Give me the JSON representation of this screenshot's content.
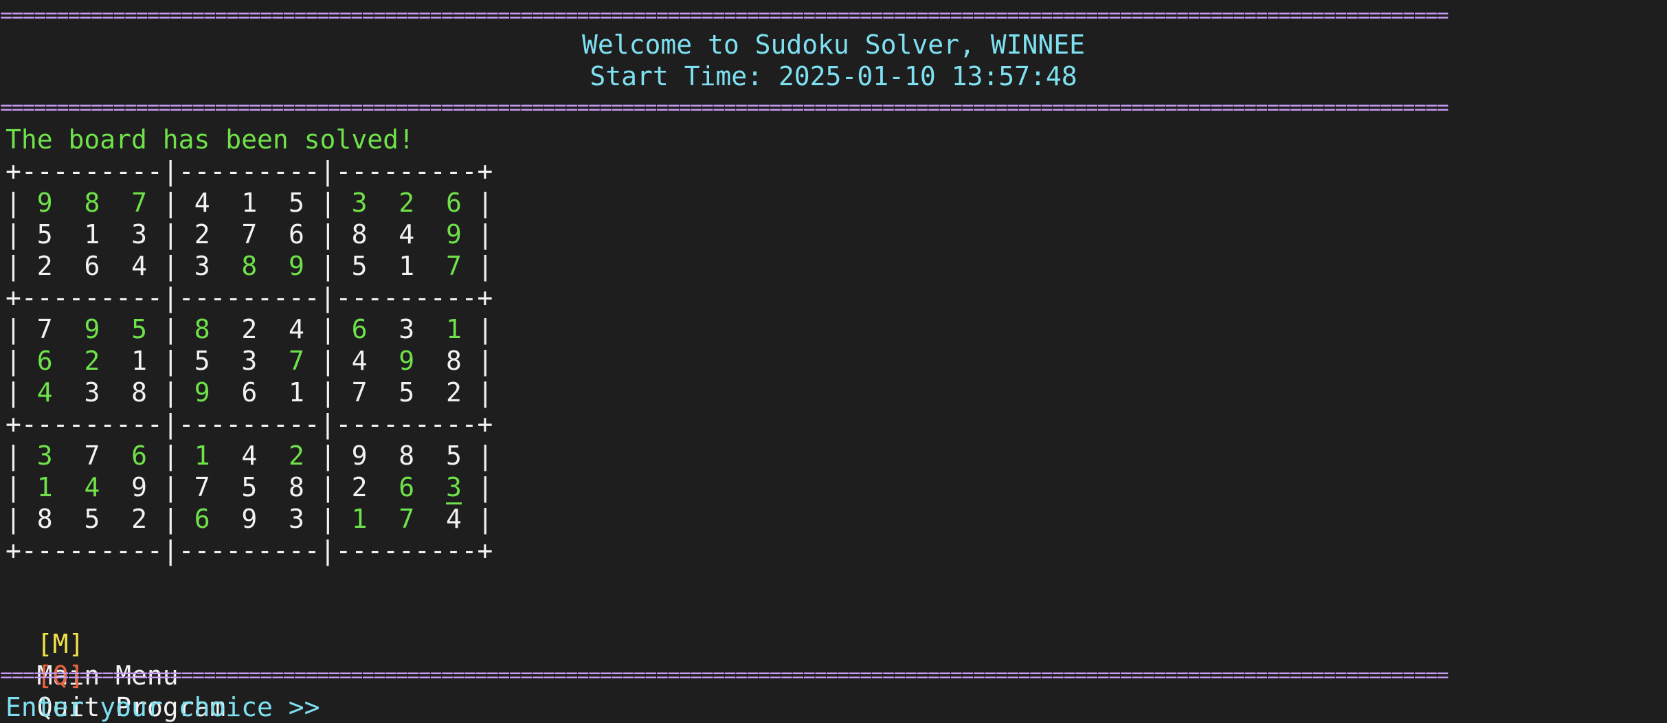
{
  "header": {
    "separator": "================================================================================================================================",
    "welcome": "Welcome to Sudoku Solver, WINNEE",
    "start_time": "Start Time: 2025-01-10 13:57:48"
  },
  "status": "The board has been solved!",
  "board": {
    "border_top": "+---------|---------|---------+",
    "border_mid": "+---------|---------|---------+",
    "border_bottom": "+---------|---------|---------+",
    "rows": [
      [
        [
          "9",
          "g"
        ],
        [
          "8",
          "g"
        ],
        [
          "7",
          "g"
        ],
        [
          "4",
          "w"
        ],
        [
          "1",
          "w"
        ],
        [
          "5",
          "w"
        ],
        [
          "3",
          "g"
        ],
        [
          "2",
          "g"
        ],
        [
          "6",
          "g"
        ]
      ],
      [
        [
          "5",
          "w"
        ],
        [
          "1",
          "w"
        ],
        [
          "3",
          "w"
        ],
        [
          "2",
          "w"
        ],
        [
          "7",
          "w"
        ],
        [
          "6",
          "w"
        ],
        [
          "8",
          "w"
        ],
        [
          "4",
          "w"
        ],
        [
          "9",
          "g"
        ]
      ],
      [
        [
          "2",
          "w"
        ],
        [
          "6",
          "w"
        ],
        [
          "4",
          "w"
        ],
        [
          "3",
          "w"
        ],
        [
          "8",
          "g"
        ],
        [
          "9",
          "g"
        ],
        [
          "5",
          "w"
        ],
        [
          "1",
          "w"
        ],
        [
          "7",
          "g"
        ]
      ],
      [
        [
          "7",
          "w"
        ],
        [
          "9",
          "g"
        ],
        [
          "5",
          "g"
        ],
        [
          "8",
          "g"
        ],
        [
          "2",
          "w"
        ],
        [
          "4",
          "w"
        ],
        [
          "6",
          "g"
        ],
        [
          "3",
          "w"
        ],
        [
          "1",
          "g"
        ]
      ],
      [
        [
          "6",
          "g"
        ],
        [
          "2",
          "g"
        ],
        [
          "1",
          "w"
        ],
        [
          "5",
          "w"
        ],
        [
          "3",
          "w"
        ],
        [
          "7",
          "g"
        ],
        [
          "4",
          "w"
        ],
        [
          "9",
          "g"
        ],
        [
          "8",
          "w"
        ]
      ],
      [
        [
          "4",
          "g"
        ],
        [
          "3",
          "w"
        ],
        [
          "8",
          "w"
        ],
        [
          "9",
          "g"
        ],
        [
          "6",
          "w"
        ],
        [
          "1",
          "w"
        ],
        [
          "7",
          "w"
        ],
        [
          "5",
          "w"
        ],
        [
          "2",
          "w"
        ]
      ],
      [
        [
          "3",
          "g"
        ],
        [
          "7",
          "w"
        ],
        [
          "6",
          "g"
        ],
        [
          "1",
          "g"
        ],
        [
          "4",
          "w"
        ],
        [
          "2",
          "g"
        ],
        [
          "9",
          "w"
        ],
        [
          "8",
          "w"
        ],
        [
          "5",
          "w"
        ]
      ],
      [
        [
          "1",
          "g"
        ],
        [
          "4",
          "g"
        ],
        [
          "9",
          "w"
        ],
        [
          "7",
          "w"
        ],
        [
          "5",
          "w"
        ],
        [
          "8",
          "w"
        ],
        [
          "2",
          "w"
        ],
        [
          "6",
          "g"
        ],
        [
          "3",
          "g"
        ]
      ],
      [
        [
          "8",
          "w"
        ],
        [
          "5",
          "w"
        ],
        [
          "2",
          "w"
        ],
        [
          "6",
          "g"
        ],
        [
          "9",
          "w"
        ],
        [
          "3",
          "w"
        ],
        [
          "1",
          "g"
        ],
        [
          "7",
          "g"
        ],
        [
          "4",
          "w"
        ]
      ]
    ]
  },
  "menu": {
    "main_key": "[M]",
    "main_label": "Main Menu",
    "quit_key": "[Q]",
    "quit_label": "Quit Program"
  },
  "prompt": "Enter your choice >>"
}
